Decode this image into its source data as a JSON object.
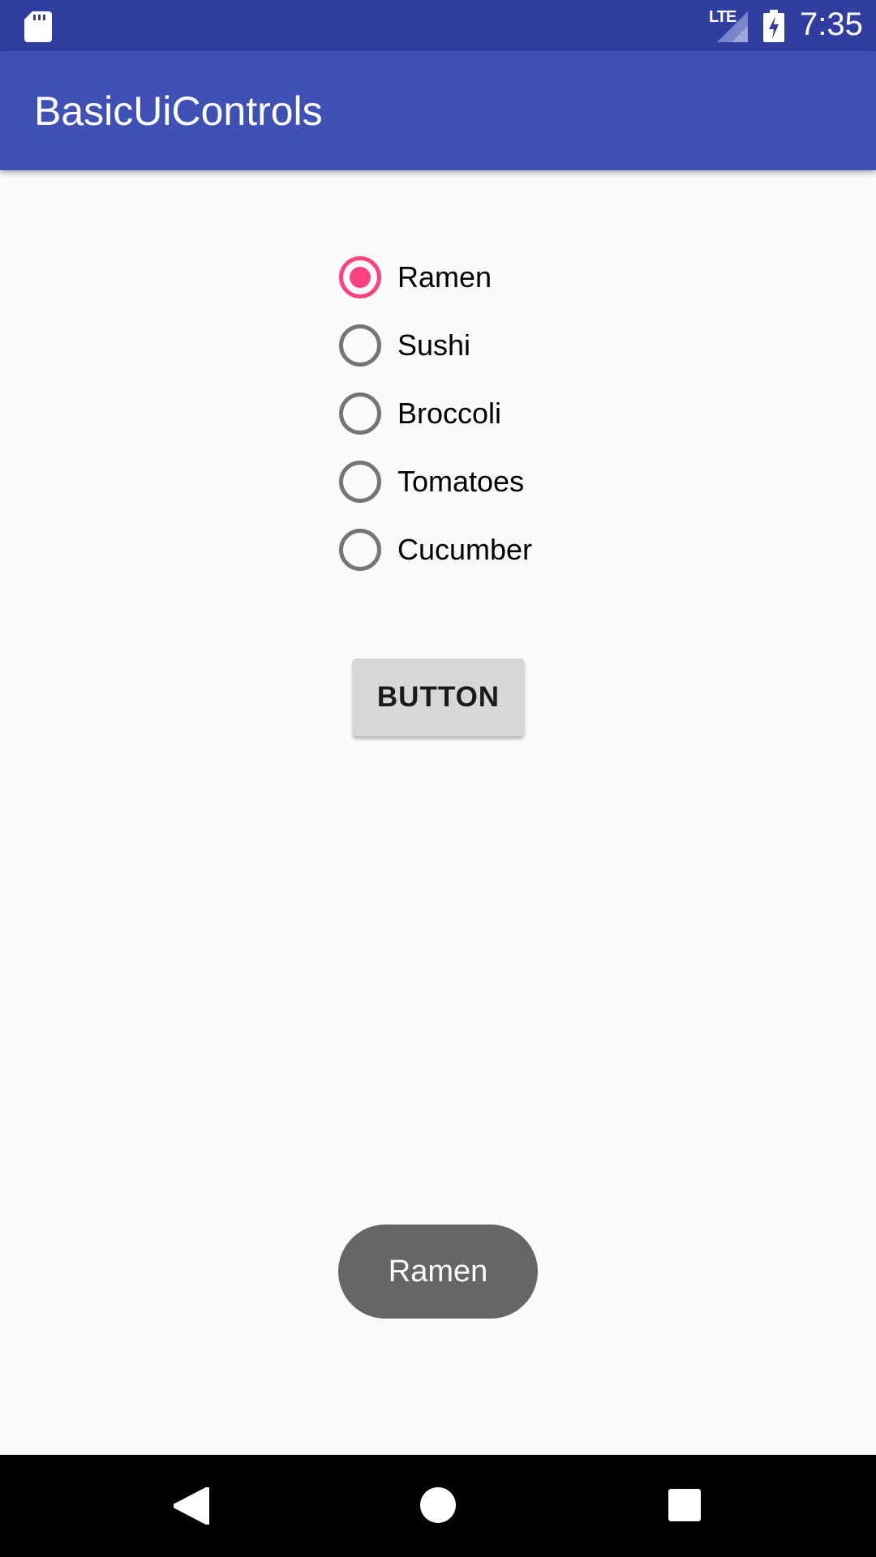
{
  "status_bar": {
    "time": "7:35",
    "network": "LTE",
    "icons": [
      "sd-card-icon",
      "signal-icon",
      "battery-charging-icon"
    ]
  },
  "app_bar": {
    "title": "BasicUiControls"
  },
  "radio_group": {
    "selected": "Ramen",
    "options": [
      {
        "label": "Ramen",
        "checked": true
      },
      {
        "label": "Sushi",
        "checked": false
      },
      {
        "label": "Broccoli",
        "checked": false
      },
      {
        "label": "Tomatoes",
        "checked": false
      },
      {
        "label": "Cucumber",
        "checked": false
      }
    ]
  },
  "button": {
    "label": "BUTTON"
  },
  "toast": {
    "message": "Ramen"
  },
  "nav_bar": {
    "icons": [
      "back-icon",
      "home-icon",
      "recents-icon"
    ]
  },
  "colors": {
    "status_bar": "#303f9f",
    "app_bar": "#3f51b5",
    "accent": "#ff4081",
    "radio_unchecked": "#757575",
    "button_bg": "#d6d7d7",
    "toast_bg": "#666666",
    "background": "#fafafa"
  }
}
